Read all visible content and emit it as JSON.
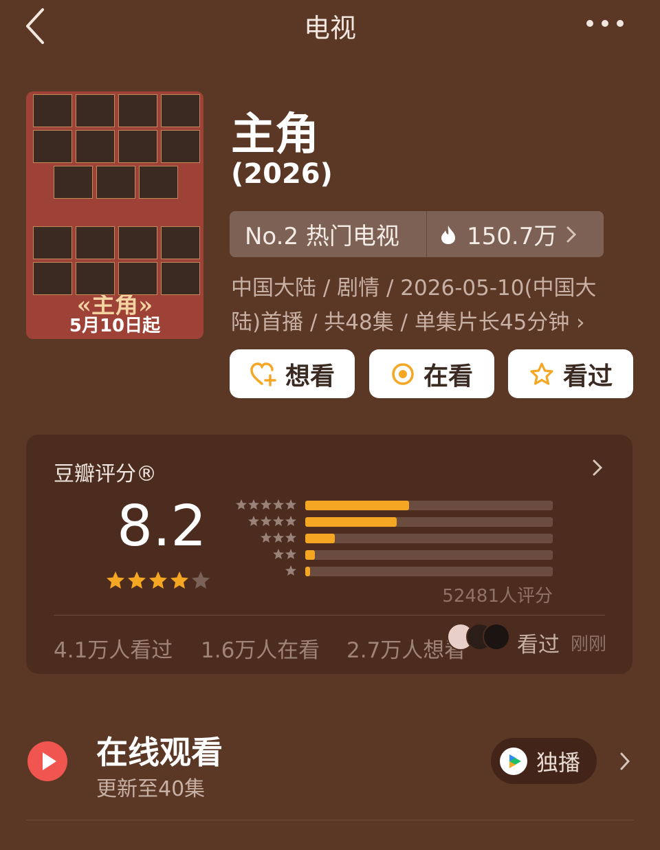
{
  "header": {
    "title": "电视"
  },
  "poster": {
    "title": "«主角»",
    "date": "5月10日起"
  },
  "show": {
    "title": "主角",
    "year": "(2026)"
  },
  "rank": {
    "label": "No.2 热门电视",
    "heat": "150.7万"
  },
  "meta": {
    "line1": "中国大陆 / 剧情 / 2026-05-10(中国大",
    "line2": "陆)首播 / 共48集 / 单集片长45分钟 ›"
  },
  "actions": {
    "want": "想看",
    "watching": "在看",
    "watched": "看过"
  },
  "rating": {
    "title": "豆瓣评分®",
    "score": "8.2",
    "stars_filled": 4,
    "count": "52481人评分",
    "distribution": [
      {
        "stars": 5,
        "percent": 42
      },
      {
        "stars": 4,
        "percent": 37
      },
      {
        "stars": 3,
        "percent": 12
      },
      {
        "stars": 2,
        "percent": 4
      },
      {
        "stars": 1,
        "percent": 2
      }
    ],
    "stats": {
      "watched": "4.1万人看过",
      "watching": "1.6万人在看",
      "want": "2.7万人想看"
    },
    "friend_action": "看过",
    "friend_time": "刚刚"
  },
  "online": {
    "title": "在线观看",
    "subtitle": "更新至40集",
    "badge": "独播"
  },
  "colors": {
    "background": "#5b3726",
    "card": "#4b2c1f",
    "accent": "#f5a623",
    "chip": "#7e6155"
  }
}
